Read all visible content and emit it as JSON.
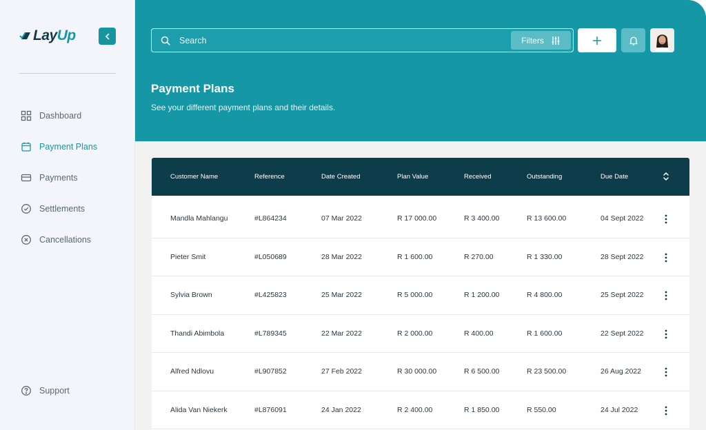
{
  "brand": {
    "name_part1": "Lay",
    "name_part2": "Up"
  },
  "sidebar": {
    "items": [
      {
        "label": "Dashboard",
        "icon": "grid-icon",
        "active": false
      },
      {
        "label": "Payment Plans",
        "icon": "calendar-icon",
        "active": true
      },
      {
        "label": "Payments",
        "icon": "card-icon",
        "active": false
      },
      {
        "label": "Settlements",
        "icon": "check-circle-icon",
        "active": false
      },
      {
        "label": "Cancellations",
        "icon": "x-circle-icon",
        "active": false
      }
    ],
    "support": {
      "label": "Support",
      "icon": "help-circle-icon"
    }
  },
  "topbar": {
    "search_placeholder": "Search",
    "filters_label": "Filters"
  },
  "page": {
    "title": "Payment Plans",
    "subtitle": "See your different payment plans and their details."
  },
  "table": {
    "columns": [
      "Customer Name",
      "Reference",
      "Date Created",
      "Plan Value",
      "Received",
      "Outstanding",
      "Due Date"
    ],
    "rows": [
      [
        "Mandla Mahlangu",
        "#L864234",
        "07 Mar 2022",
        "R 17 000.00",
        "R 3 400.00",
        "R 13 600.00",
        "04 Sept 2022"
      ],
      [
        "Pieter Smit",
        "#L050689",
        "28 Mar 2022",
        "R 1 600.00",
        "R 270.00",
        "R 1 330.00",
        "28 Sept 2022"
      ],
      [
        "Sylvia Brown",
        "#L425823",
        "25 Mar 2022",
        "R 5 000.00",
        "R 1 200.00",
        "R 4 800.00",
        "25 Sept 2022"
      ],
      [
        "Thandi Abimbola",
        "#L789345",
        "22 Mar 2022",
        "R 2 000.00",
        "R 400.00",
        "R 1 600.00",
        "22 Sept 2022"
      ],
      [
        "Alfred Ndlovu",
        "#L907852",
        "27 Feb 2022",
        "R 30 000.00",
        "R 6 500.00",
        "R 23 500.00",
        "26 Aug 2022"
      ],
      [
        "Alida Van Niekerk",
        "#L876091",
        "24 Jan 2022",
        "R 2 400.00",
        "R 1 850.00",
        "R 550.00",
        "24 Jul 2022"
      ]
    ]
  },
  "colors": {
    "accent": "#1597a6",
    "header_dark": "#0d3d4b",
    "sidebar_bg": "#f4f5fa"
  }
}
